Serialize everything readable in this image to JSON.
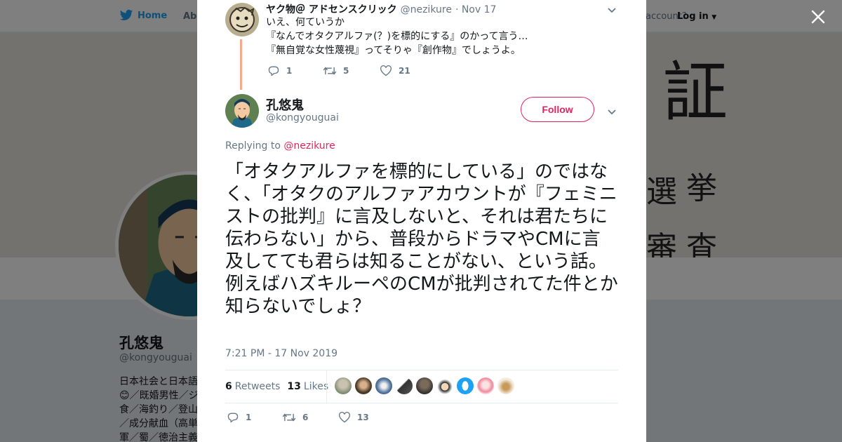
{
  "background": {
    "nav": {
      "home_label": "Home",
      "about_label": "Abo",
      "account_prompt": "account?",
      "login_label": "Log in"
    },
    "banner_kanji": [
      "証",
      "選",
      "挙",
      "審",
      "査"
    ],
    "profile": {
      "name": "孔悠鬼",
      "handle": "@kongyouguai",
      "bio_lines": [
        "日本社会と日本語",
        "😊／既婚男性／ジ",
        "食／海釣り／登山",
        "／成分献血（高単",
        "軍／蜀／徳治主義"
      ]
    }
  },
  "parent_tweet": {
    "author_name": "ヤク物＠ アドセンスクリック",
    "author_handle": "@nezikure",
    "date": "· Nov 17",
    "lines": [
      "いえ、何ていうか",
      "『なんでオタクアルファ(？)を標的にする』のかって言う…",
      "『無自覚な女性蔑視』ってそりゃ『創作物』でしょうよ。"
    ],
    "replies": "1",
    "retweets": "5",
    "likes": "21"
  },
  "main_tweet": {
    "author_name": "孔悠鬼",
    "author_handle": "@kongyouguai",
    "follow_label": "Follow",
    "replying_prefix": "Replying to",
    "replying_to": "@nezikure",
    "text": "「オタクアルファを標的にしている」のではなく、「オタクのアルファアカウントが『フェミニストの批判』に言及しないと、それは君たちに伝わらない」から、普段からドラマやCMに言及してても君らは知ることがない、という話。\n例えばハズキルーペのCMが批判されてた件とか知らないでしょ？",
    "timestamp": "7:21 PM - 17 Nov 2019",
    "retweet_count": "6",
    "retweet_label": "Retweets",
    "like_count": "13",
    "like_label": "Likes",
    "replies": "1",
    "retweets": "6",
    "likes": "13"
  },
  "colors": {
    "accent": "#e0245e",
    "twitter_blue": "#1da1f2",
    "thread_line": "#f7a98d",
    "muted_text": "#657786"
  },
  "icons": [
    "twitter-bird-icon",
    "close-icon",
    "chevron-down-icon",
    "reply-icon",
    "retweet-icon",
    "heart-icon"
  ]
}
